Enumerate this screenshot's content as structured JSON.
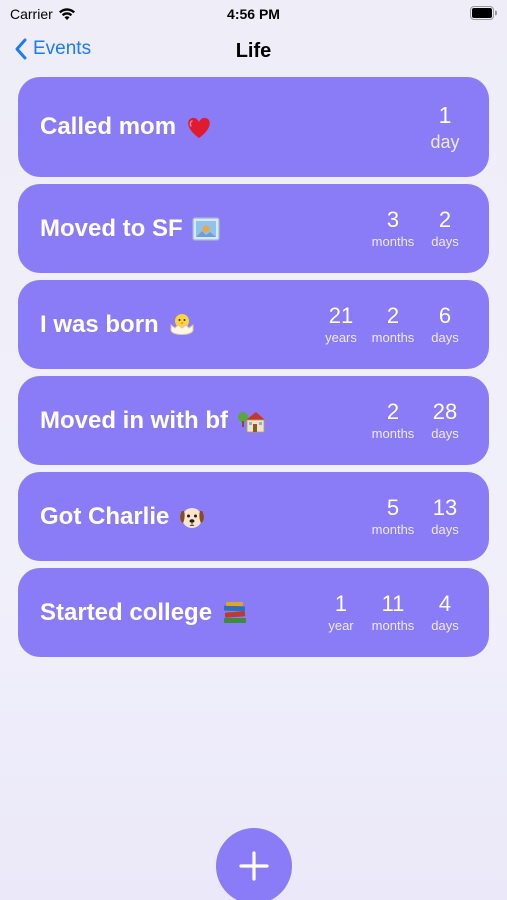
{
  "status_bar": {
    "carrier": "Carrier",
    "time": "4:56 PM"
  },
  "nav": {
    "back_label": "Events",
    "title": "Life"
  },
  "events": [
    {
      "title": "Called mom",
      "emoji": "heart",
      "units": [
        {
          "num": "1",
          "label": "day"
        }
      ]
    },
    {
      "title": "Moved to SF",
      "emoji": "picture",
      "units": [
        {
          "num": "3",
          "label": "months"
        },
        {
          "num": "2",
          "label": "days"
        }
      ]
    },
    {
      "title": "I was born",
      "emoji": "hatching-chick",
      "units": [
        {
          "num": "21",
          "label": "years"
        },
        {
          "num": "2",
          "label": "months"
        },
        {
          "num": "6",
          "label": "days"
        }
      ]
    },
    {
      "title": "Moved in with bf",
      "emoji": "house",
      "units": [
        {
          "num": "2",
          "label": "months"
        },
        {
          "num": "28",
          "label": "days"
        }
      ]
    },
    {
      "title": "Got Charlie",
      "emoji": "dog",
      "units": [
        {
          "num": "5",
          "label": "months"
        },
        {
          "num": "13",
          "label": "days"
        }
      ]
    },
    {
      "title": "Started college",
      "emoji": "books",
      "units": [
        {
          "num": "1",
          "label": "year"
        },
        {
          "num": "11",
          "label": "months"
        },
        {
          "num": "4",
          "label": "days"
        }
      ]
    }
  ],
  "fab": {
    "icon": "plus-icon"
  },
  "colors": {
    "card": "#8a7bf6",
    "accent": "#1a7cf6",
    "background": "#efeef9"
  }
}
